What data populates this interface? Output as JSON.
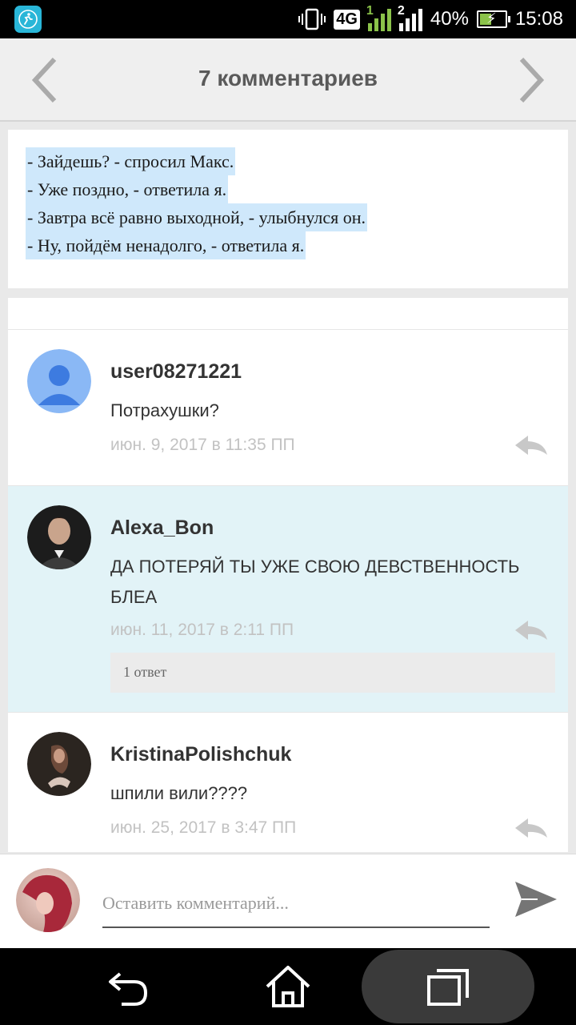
{
  "status_bar": {
    "network": "4G",
    "sim1": "1",
    "sim2": "2",
    "battery": "40%",
    "time": "15:08",
    "icons": [
      "running-app-icon",
      "vibrate-icon",
      "signal-icon",
      "battery-charging-icon"
    ]
  },
  "header": {
    "title": "7 комментариев"
  },
  "post": {
    "lines": [
      "- Зайдешь? - спросил Макс.",
      "- Уже поздно, - ответила я.",
      "- Завтра всё равно выходной, - улыбнулся он.",
      "- Ну, пойдём ненадолго, - ответила я."
    ]
  },
  "comments": [
    {
      "author": "user08271221",
      "text": "Потрахушки?",
      "date": "июн. 9, 2017 в 11:35 ПП",
      "avatar": "default-user-icon"
    },
    {
      "author": "Alexa_Bon",
      "text": "ДА ПОТЕРЯЙ ТЫ УЖЕ СВОЮ ДЕВСТВЕННОСТЬ БЛЕА",
      "date": "июн. 11, 2017 в 2:11 ПП",
      "replies": "1 ответ",
      "avatar": "photo-avatar"
    },
    {
      "author": "KristinaPolishchuk",
      "text": "шпили вили????",
      "date": "июн. 25, 2017 в 3:47 ПП",
      "avatar": "photo-avatar"
    }
  ],
  "composer": {
    "placeholder": "Оставить комментарий..."
  },
  "colors": {
    "highlight": "#cfe8fb",
    "selected_comment_bg": "#e2f3f7",
    "default_avatar": "#8ab8f5",
    "default_avatar_figure": "#3d7be0"
  }
}
